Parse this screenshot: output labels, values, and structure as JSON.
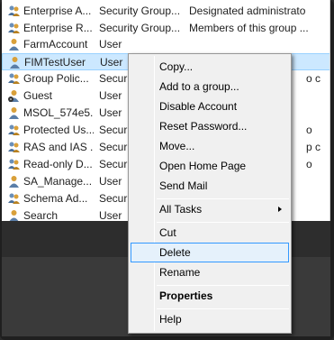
{
  "list": {
    "rows": [
      {
        "name": "Enterprise A...",
        "type": "Security Group...",
        "desc": "Designated administrato",
        "icon": "group-icon"
      },
      {
        "name": "Enterprise R...",
        "type": "Security Group...",
        "desc": "Members of this group ...",
        "icon": "group-icon"
      },
      {
        "name": "FarmAccount",
        "type": "User",
        "desc": "",
        "icon": "user-icon"
      },
      {
        "name": "FIMTestUser",
        "type": "User",
        "desc": "",
        "icon": "user-icon",
        "selected": true
      },
      {
        "name": "Group Polic...",
        "type": "Securi",
        "desc": "o c",
        "icon": "group-icon"
      },
      {
        "name": "Guest",
        "type": "User",
        "desc": "",
        "icon": "disabled-user-icon"
      },
      {
        "name": "MSOL_574e5...",
        "type": "User",
        "desc": "",
        "icon": "user-icon"
      },
      {
        "name": "Protected Us...",
        "type": "Securi",
        "desc": "o",
        "icon": "group-icon"
      },
      {
        "name": "RAS and IAS ...",
        "type": "Securi",
        "desc": "p c",
        "icon": "group-icon"
      },
      {
        "name": "Read-only D...",
        "type": "Securi",
        "desc": "o",
        "icon": "group-icon"
      },
      {
        "name": "SA_Manage...",
        "type": "User",
        "desc": "",
        "icon": "user-icon"
      },
      {
        "name": "Schema Ad...",
        "type": "Securi",
        "desc": "",
        "icon": "group-icon"
      },
      {
        "name": "Search",
        "type": "User",
        "desc": "",
        "icon": "user-icon"
      }
    ]
  },
  "context_menu": {
    "items": [
      {
        "label": "Copy...",
        "name": "menu-item-copy"
      },
      {
        "label": "Add to a group...",
        "name": "menu-item-add-to-group"
      },
      {
        "label": "Disable Account",
        "name": "menu-item-disable-account"
      },
      {
        "label": "Reset Password...",
        "name": "menu-item-reset-password"
      },
      {
        "label": "Move...",
        "name": "menu-item-move"
      },
      {
        "label": "Open Home Page",
        "name": "menu-item-open-home-page"
      },
      {
        "label": "Send Mail",
        "name": "menu-item-send-mail"
      },
      {
        "label": "All Tasks",
        "name": "menu-item-all-tasks",
        "submenu": true
      },
      {
        "label": "Cut",
        "name": "menu-item-cut"
      },
      {
        "label": "Delete",
        "name": "menu-item-delete",
        "highlighted": true
      },
      {
        "label": "Rename",
        "name": "menu-item-rename"
      },
      {
        "label": "Properties",
        "name": "menu-item-properties",
        "bold": true
      },
      {
        "label": "Help",
        "name": "menu-item-help"
      }
    ]
  },
  "colors": {
    "selection_bg": "#cce8ff",
    "menu_highlight": "#e5f1fb",
    "menu_highlight_border": "#3399ff"
  }
}
